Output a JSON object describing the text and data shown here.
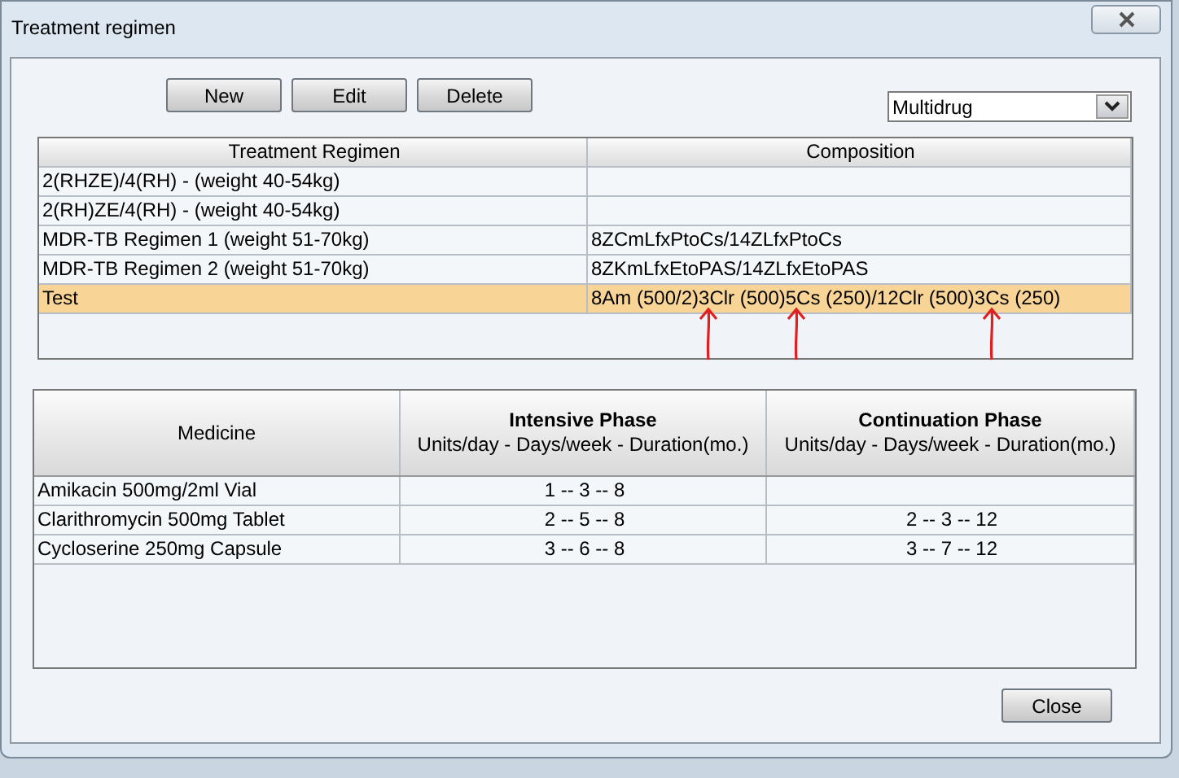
{
  "window": {
    "title": "Treatment regimen"
  },
  "toolbar": {
    "buttons": [
      "New",
      "Edit",
      "Delete"
    ],
    "filter": {
      "value": "Multidrug"
    }
  },
  "regimens": {
    "columns": [
      "Treatment Regimen",
      "Composition"
    ],
    "rows": [
      {
        "cells": [
          "2(RHZE)/4(RH) - (weight 40-54kg)",
          ""
        ],
        "selected": false
      },
      {
        "cells": [
          "2(RH)ZE/4(RH) - (weight 40-54kg)",
          ""
        ],
        "selected": false
      },
      {
        "cells": [
          "MDR-TB Regimen 1 (weight 51-70kg)",
          "8ZCmLfxPtoCs/14ZLfxPtoCs"
        ],
        "selected": false
      },
      {
        "cells": [
          "MDR-TB Regimen 2 (weight 51-70kg)",
          "8ZKmLfxEtoPAS/14ZLfxEtoPAS"
        ],
        "selected": false
      },
      {
        "cells": [
          "Test",
          "8Am (500/2)3Clr (500)5Cs (250)/12Clr (500)3Cs (250)"
        ],
        "selected": true
      }
    ]
  },
  "annotations": [
    {
      "kind": "arrow"
    },
    {
      "kind": "arrow"
    },
    {
      "kind": "arrow"
    }
  ],
  "medicines": {
    "columns": [
      {
        "title": "Medicine"
      },
      {
        "title": "Intensive Phase",
        "subtitle": "Units/day - Days/week - Duration(mo.)"
      },
      {
        "title": "Continuation Phase",
        "subtitle": "Units/day - Days/week - Duration(mo.)"
      }
    ],
    "rows": [
      [
        "Amikacin 500mg/2ml Vial",
        "1 -- 3 -- 8",
        ""
      ],
      [
        "Clarithromycin 500mg Tablet",
        "2 -- 5 -- 8",
        "2 -- 3 -- 12"
      ],
      [
        "Cycloserine 250mg Capsule",
        "3 -- 6 -- 8",
        "3 -- 7 -- 12"
      ]
    ]
  },
  "footer": {
    "button": "Close"
  }
}
